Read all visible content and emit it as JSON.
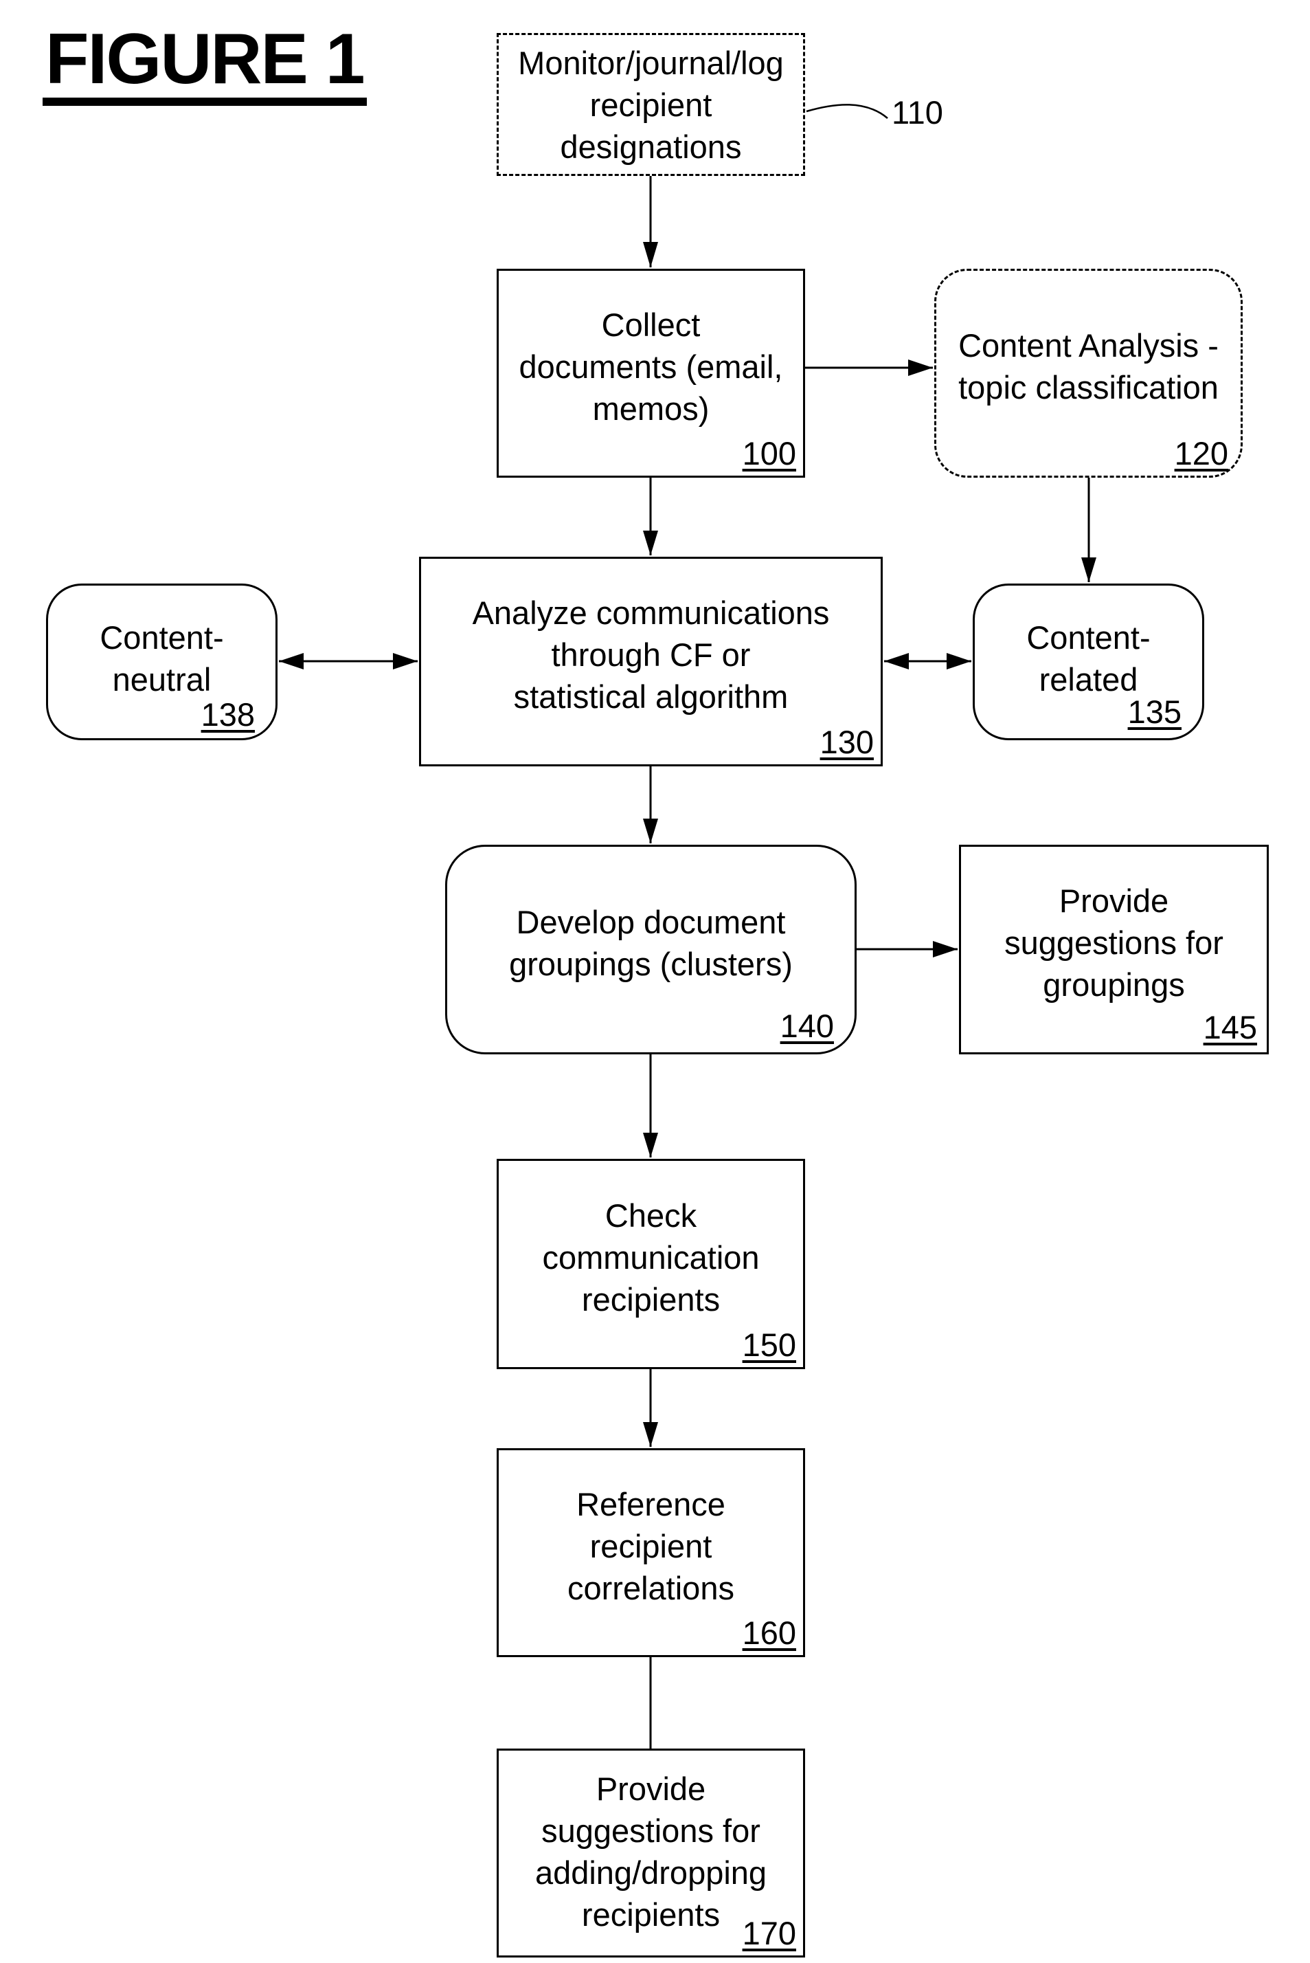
{
  "figure_title": "FIGURE 1",
  "nodes": {
    "n110": {
      "text": "Monitor/journal/log\nrecipient\ndesignations",
      "ref": "",
      "style": "dashed"
    },
    "n100": {
      "text": "Collect\ndocuments (email,\nmemos)",
      "ref": "100",
      "style": "solid"
    },
    "n120": {
      "text": "Content Analysis -\ntopic classification",
      "ref": "120",
      "style": "dashed-rounded"
    },
    "n130": {
      "text": "Analyze communications\nthrough CF or\nstatistical algorithm",
      "ref": "130",
      "style": "solid"
    },
    "n138": {
      "text": "Content-\nneutral",
      "ref": "138",
      "style": "rounded"
    },
    "n135": {
      "text": "Content-\nrelated",
      "ref": "135",
      "style": "rounded"
    },
    "n140": {
      "text": "Develop document\ngroupings (clusters)",
      "ref": "140",
      "style": "rounded"
    },
    "n145": {
      "text": "Provide\nsuggestions for\ngroupings",
      "ref": "145",
      "style": "solid"
    },
    "n150": {
      "text": "Check\ncommunication\nrecipients",
      "ref": "150",
      "style": "solid"
    },
    "n160": {
      "text": "Reference\nrecipient\ncorrelations",
      "ref": "160",
      "style": "solid"
    },
    "n170": {
      "text": "Provide\nsuggestions for\nadding/dropping\nrecipients",
      "ref": "170",
      "style": "solid"
    }
  },
  "callouts": {
    "c110": "110"
  },
  "edges": [
    {
      "from": "110",
      "to": "100",
      "type": "arrow"
    },
    {
      "from": "100",
      "to": "120",
      "type": "arrow"
    },
    {
      "from": "100",
      "to": "130",
      "type": "arrow"
    },
    {
      "from": "120",
      "to": "135",
      "type": "arrow"
    },
    {
      "from": "130",
      "to": "138",
      "type": "bidirectional"
    },
    {
      "from": "130",
      "to": "135",
      "type": "bidirectional"
    },
    {
      "from": "130",
      "to": "140",
      "type": "arrow"
    },
    {
      "from": "140",
      "to": "145",
      "type": "arrow"
    },
    {
      "from": "140",
      "to": "150",
      "type": "arrow"
    },
    {
      "from": "150",
      "to": "160",
      "type": "arrow"
    },
    {
      "from": "160",
      "to": "170",
      "type": "line"
    }
  ]
}
